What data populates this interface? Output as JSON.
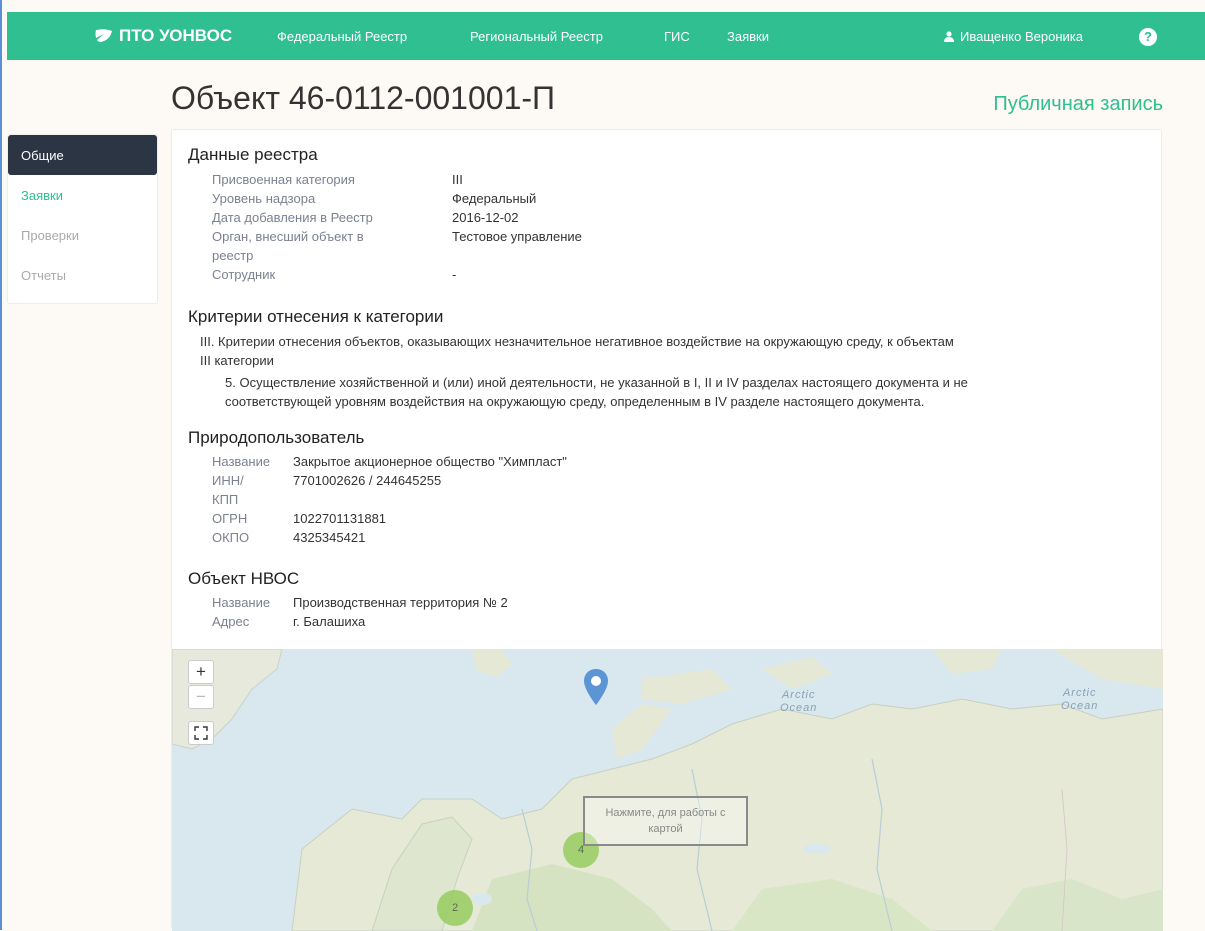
{
  "navbar": {
    "brand": "ПТО УОНВОС",
    "links": [
      "Федеральный Реестр",
      "Региональный Реестр",
      "ГИС",
      "Заявки"
    ],
    "user": "Иващенко Вероника",
    "help": "?"
  },
  "header": {
    "title": "Объект 46-0112-001001-П",
    "public_label": "Публичная запись"
  },
  "sidebar": {
    "items": [
      {
        "label": "Общие"
      },
      {
        "label": "Заявки"
      },
      {
        "label": "Проверки"
      },
      {
        "label": "Отчеты"
      }
    ]
  },
  "registry": {
    "title": "Данные реестра",
    "rows": [
      {
        "key": "Присвоенная категория",
        "value": "III"
      },
      {
        "key": "Уровень надзора",
        "value": "Федеральный"
      },
      {
        "key": "Дата добавления в Реестр",
        "value": "2016-12-02"
      },
      {
        "key": "Орган, внесший объект в",
        "key2": "реестр",
        "value": "Тестовое управление"
      },
      {
        "key": "Сотрудник",
        "value": "-"
      }
    ]
  },
  "criteria": {
    "title": "Критерии отнесения к категории",
    "main_line1": "III. Критерии отнесения объектов, оказывающих незначительное негативное воздействие на окружающую среду, к объектам",
    "main_line2": "III категории",
    "sub_line1": "5. Осуществление хозяйственной и (или) иной деятельности, не указанной в I, II и IV разделах настоящего документа и не",
    "sub_line2": "соответствующей уровням воздействия на окружающую среду, определенным в IV разделе настоящего документа."
  },
  "user_of_nature": {
    "title": "Природопользователь",
    "name_key": "Название",
    "name_value": "Закрытое акционерное общество \"Химпласт\"",
    "inn_key": "ИНН/",
    "inn_key2": "КПП",
    "inn_value": "7701002626 / 244645255",
    "ogrn_key": "ОГРН",
    "ogrn_value": "1022701131881",
    "okpo_key": "ОКПО",
    "okpo_value": "4325345421"
  },
  "object": {
    "title": "Объект НВОС",
    "name_key": "Название",
    "name_value": "Производственная территория № 2",
    "address_key": "Адрес",
    "address_value": "г. Балашиха"
  },
  "map": {
    "zoom_in": "+",
    "zoom_out": "−",
    "fullscreen_icon": "fullscreen-icon",
    "ocean_label_1a": "Arctic",
    "ocean_label_1b": "Ocean",
    "ocean_label_2a": "Arctic",
    "ocean_label_2b": "Ocean",
    "hint_line1": "Нажмите, для работы с",
    "hint_line2": "картой",
    "cluster_1": "4",
    "cluster_2": "2",
    "colors": {
      "water": "#d7e9ef",
      "land": "#e4e8d5",
      "cluster": "#8cc850",
      "marker": "#5b95d6"
    }
  },
  "colors": {
    "accent": "#2fbf91",
    "sidebar_active": "#2b3543"
  }
}
